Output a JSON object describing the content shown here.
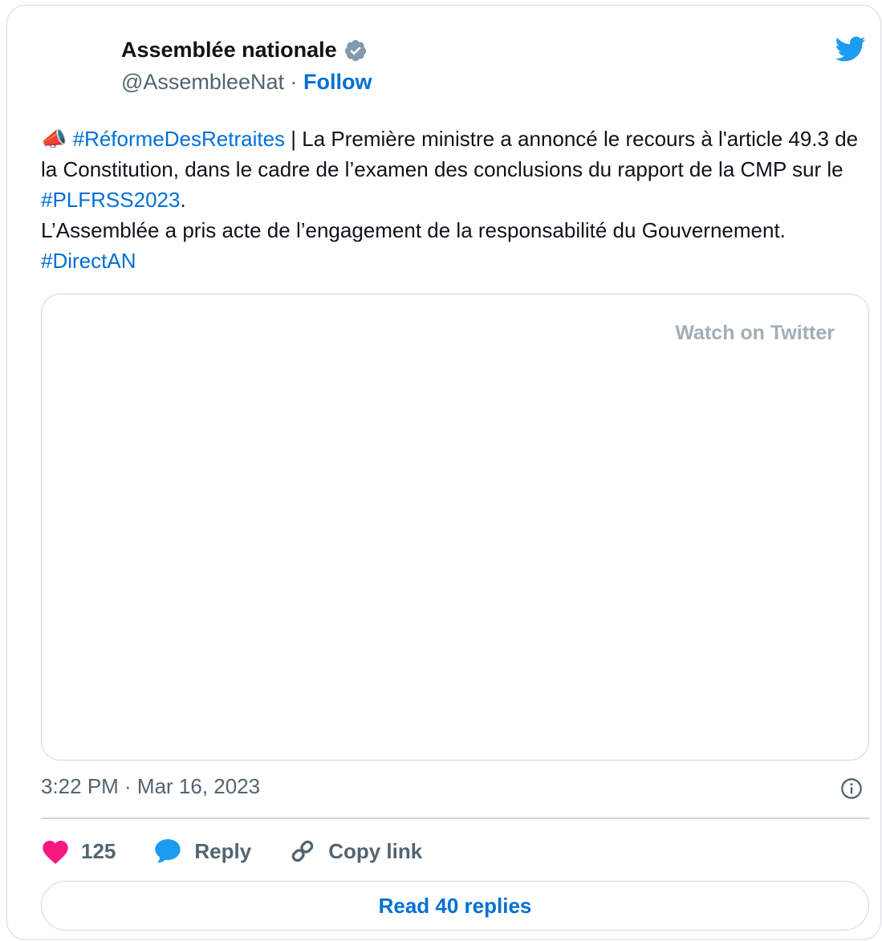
{
  "author": {
    "name": "Assemblée nationale",
    "handle": "@AssembleeNat",
    "separator": "·",
    "follow_label": "Follow"
  },
  "tweet": {
    "emoji": "📣",
    "hashtag1": "#RéformeDesRetraites",
    "text1": " | La Première ministre a annoncé le recours à l'article 49.3 de la Constitution, dans le cadre de l’examen des conclusions du rapport de la CMP sur le ",
    "hashtag2": "#PLFRSS2023",
    "text2": ".",
    "text3": "L’Assemblée a pris acte de l’engagement de la responsabilité du Gouvernement.",
    "hashtag3": "#DirectAN"
  },
  "media": {
    "watch_label": "Watch on Twitter"
  },
  "timestamp": "3:22 PM · Mar 16, 2023",
  "actions": {
    "like_count": "125",
    "reply_label": "Reply",
    "copy_label": "Copy link"
  },
  "read_replies_label": "Read 40 replies",
  "colors": {
    "link": "#006fd6",
    "twitter_blue": "#1d9bf0",
    "like_pink": "#f91880",
    "muted": "#536471",
    "border": "#cfd9de"
  }
}
